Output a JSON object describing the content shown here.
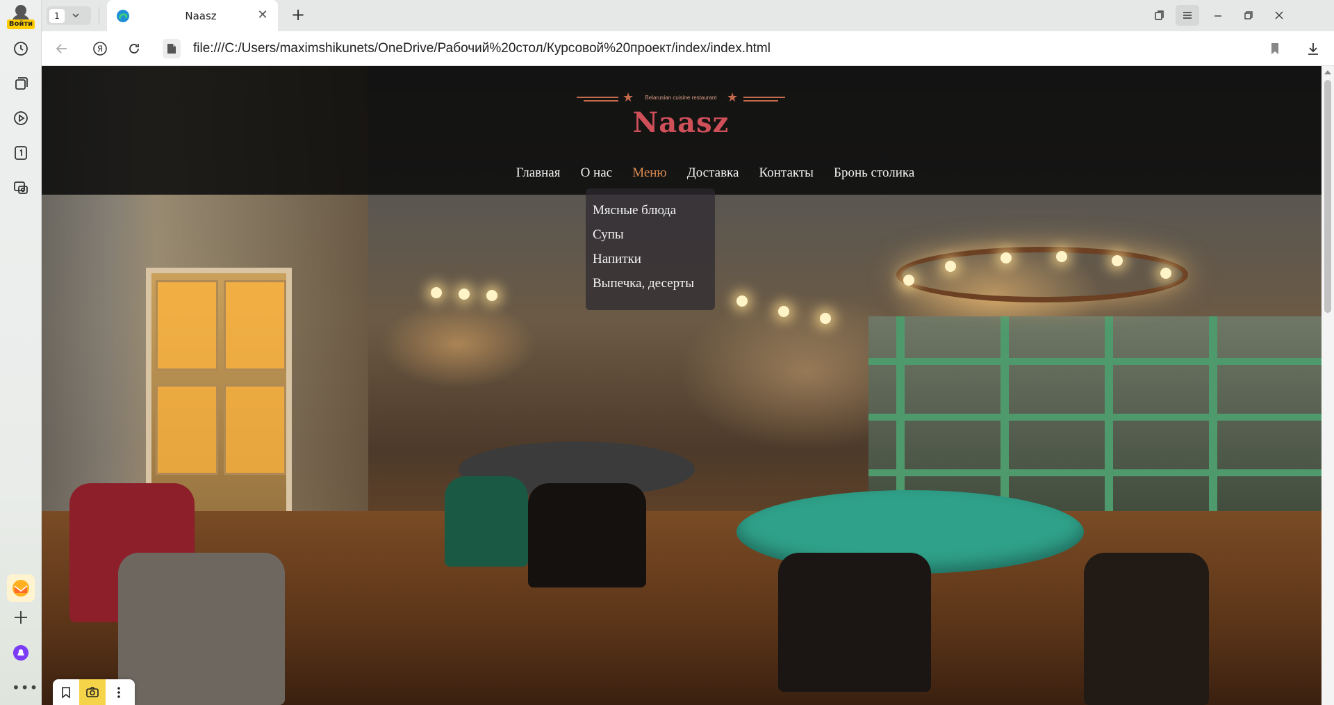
{
  "profile": {
    "signin_label": "Войти"
  },
  "tabs": {
    "count": "1",
    "active_title": "Naasz"
  },
  "address": {
    "url": "file:///C:/Users/maximshikunets/OneDrive/Рабочий%20стол/Курсовой%20проект/index/index.html"
  },
  "sidebar_icons": [
    "history-icon",
    "collections-icon",
    "play-icon",
    "tab-counter-icon",
    "screenshot-icon",
    "mail-app-icon",
    "add-icon",
    "alice-assistant-icon",
    "more-icon"
  ],
  "site": {
    "tagline": "Belarusian cuisine restaurant",
    "brand": "Naasz",
    "nav": [
      {
        "label": "Главная",
        "active": false
      },
      {
        "label": "О нас",
        "active": false
      },
      {
        "label": "Меню",
        "active": true
      },
      {
        "label": "Доставка",
        "active": false
      },
      {
        "label": "Контакты",
        "active": false
      },
      {
        "label": "Бронь столика",
        "active": false
      }
    ],
    "menu_dropdown": [
      "Мясные блюда",
      "Супы",
      "Напитки",
      "Выпечка, десерты"
    ]
  },
  "colors": {
    "brand": "#d0505a",
    "accent_nav": "#d8894e",
    "header_bg": "#0a0a0a",
    "sidebar_signin": "#ffcc00"
  }
}
